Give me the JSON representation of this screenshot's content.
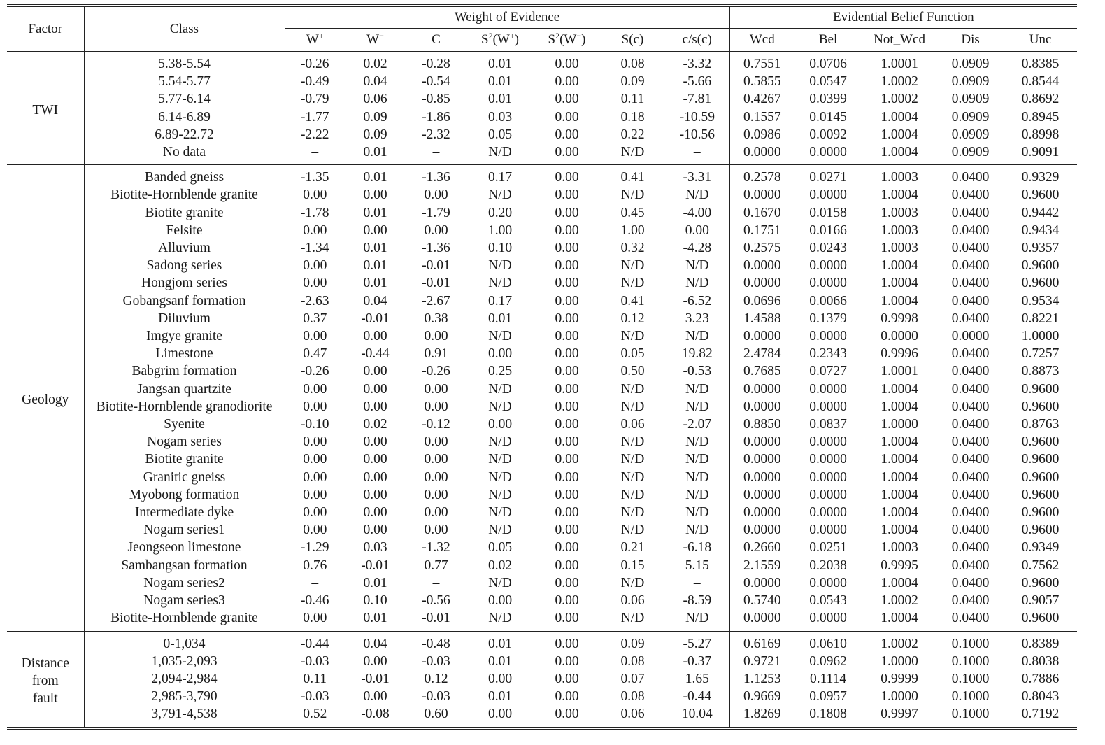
{
  "header": {
    "factor": "Factor",
    "class": "Class",
    "woe_group": "Weight of Evidence",
    "ebf_group": "Evidential Belief Function",
    "columns": [
      {
        "base": "W",
        "sup": "+"
      },
      {
        "base": "W",
        "sup": "−"
      },
      {
        "base": "C",
        "sup": ""
      },
      {
        "base": "S",
        "sup": "2",
        "tail": "(W",
        "sup2": "+",
        "end": ")"
      },
      {
        "base": "S",
        "sup": "2",
        "tail": "(W",
        "sup2": "−",
        "end": ")"
      },
      {
        "base": "S(c)",
        "sup": ""
      },
      {
        "base": "c/s(c)",
        "sup": ""
      },
      {
        "base": "Wcd",
        "sup": ""
      },
      {
        "base": "Bel",
        "sup": ""
      },
      {
        "base": "Not_Wcd",
        "sup": ""
      },
      {
        "base": "Dis",
        "sup": ""
      },
      {
        "base": "Unc",
        "sup": ""
      }
    ]
  },
  "groups": [
    {
      "factor": "TWI",
      "rows": [
        [
          "5.38-5.54",
          "-0.26",
          "0.02",
          "-0.28",
          "0.01",
          "0.00",
          "0.08",
          "-3.32",
          "0.7551",
          "0.0706",
          "1.0001",
          "0.0909",
          "0.8385"
        ],
        [
          "5.54-5.77",
          "-0.49",
          "0.04",
          "-0.54",
          "0.01",
          "0.00",
          "0.09",
          "-5.66",
          "0.5855",
          "0.0547",
          "1.0002",
          "0.0909",
          "0.8544"
        ],
        [
          "5.77-6.14",
          "-0.79",
          "0.06",
          "-0.85",
          "0.01",
          "0.00",
          "0.11",
          "-7.81",
          "0.4267",
          "0.0399",
          "1.0002",
          "0.0909",
          "0.8692"
        ],
        [
          "6.14-6.89",
          "-1.77",
          "0.09",
          "-1.86",
          "0.03",
          "0.00",
          "0.18",
          "-10.59",
          "0.1557",
          "0.0145",
          "1.0004",
          "0.0909",
          "0.8945"
        ],
        [
          "6.89-22.72",
          "-2.22",
          "0.09",
          "-2.32",
          "0.05",
          "0.00",
          "0.22",
          "-10.56",
          "0.0986",
          "0.0092",
          "1.0004",
          "0.0909",
          "0.8998"
        ],
        [
          "No data",
          "–",
          "0.01",
          "–",
          "N/D",
          "0.00",
          "N/D",
          "–",
          "0.0000",
          "0.0000",
          "1.0004",
          "0.0909",
          "0.9091"
        ]
      ]
    },
    {
      "factor": "Geology",
      "rows": [
        [
          "Banded gneiss",
          "-1.35",
          "0.01",
          "-1.36",
          "0.17",
          "0.00",
          "0.41",
          "-3.31",
          "0.2578",
          "0.0271",
          "1.0003",
          "0.0400",
          "0.9329"
        ],
        [
          "Biotite-Hornblende granite",
          "0.00",
          "0.00",
          "0.00",
          "N/D",
          "0.00",
          "N/D",
          "N/D",
          "0.0000",
          "0.0000",
          "1.0004",
          "0.0400",
          "0.9600"
        ],
        [
          "Biotite granite",
          "-1.78",
          "0.01",
          "-1.79",
          "0.20",
          "0.00",
          "0.45",
          "-4.00",
          "0.1670",
          "0.0158",
          "1.0003",
          "0.0400",
          "0.9442"
        ],
        [
          "Felsite",
          "0.00",
          "0.00",
          "0.00",
          "1.00",
          "0.00",
          "1.00",
          "0.00",
          "0.1751",
          "0.0166",
          "1.0003",
          "0.0400",
          "0.9434"
        ],
        [
          "Alluvium",
          "-1.34",
          "0.01",
          "-1.36",
          "0.10",
          "0.00",
          "0.32",
          "-4.28",
          "0.2575",
          "0.0243",
          "1.0003",
          "0.0400",
          "0.9357"
        ],
        [
          "Sadong series",
          "0.00",
          "0.01",
          "-0.01",
          "N/D",
          "0.00",
          "N/D",
          "N/D",
          "0.0000",
          "0.0000",
          "1.0004",
          "0.0400",
          "0.9600"
        ],
        [
          "Hongjom series",
          "0.00",
          "0.01",
          "-0.01",
          "N/D",
          "0.00",
          "N/D",
          "N/D",
          "0.0000",
          "0.0000",
          "1.0004",
          "0.0400",
          "0.9600"
        ],
        [
          "Gobangsanf formation",
          "-2.63",
          "0.04",
          "-2.67",
          "0.17",
          "0.00",
          "0.41",
          "-6.52",
          "0.0696",
          "0.0066",
          "1.0004",
          "0.0400",
          "0.9534"
        ],
        [
          "Diluvium",
          "0.37",
          "-0.01",
          "0.38",
          "0.01",
          "0.00",
          "0.12",
          "3.23",
          "1.4588",
          "0.1379",
          "0.9998",
          "0.0400",
          "0.8221"
        ],
        [
          "Imgye granite",
          "0.00",
          "0.00",
          "0.00",
          "N/D",
          "0.00",
          "N/D",
          "N/D",
          "0.0000",
          "0.0000",
          "0.0000",
          "0.0000",
          "1.0000"
        ],
        [
          "Limestone",
          "0.47",
          "-0.44",
          "0.91",
          "0.00",
          "0.00",
          "0.05",
          "19.82",
          "2.4784",
          "0.2343",
          "0.9996",
          "0.0400",
          "0.7257"
        ],
        [
          "Babgrim formation",
          "-0.26",
          "0.00",
          "-0.26",
          "0.25",
          "0.00",
          "0.50",
          "-0.53",
          "0.7685",
          "0.0727",
          "1.0001",
          "0.0400",
          "0.8873"
        ],
        [
          "Jangsan quartzite",
          "0.00",
          "0.00",
          "0.00",
          "N/D",
          "0.00",
          "N/D",
          "N/D",
          "0.0000",
          "0.0000",
          "1.0004",
          "0.0400",
          "0.9600"
        ],
        [
          "Biotite-Hornblende granodiorite",
          "0.00",
          "0.00",
          "0.00",
          "N/D",
          "0.00",
          "N/D",
          "N/D",
          "0.0000",
          "0.0000",
          "1.0004",
          "0.0400",
          "0.9600"
        ],
        [
          "Syenite",
          "-0.10",
          "0.02",
          "-0.12",
          "0.00",
          "0.00",
          "0.06",
          "-2.07",
          "0.8850",
          "0.0837",
          "1.0000",
          "0.0400",
          "0.8763"
        ],
        [
          "Nogam series",
          "0.00",
          "0.00",
          "0.00",
          "N/D",
          "0.00",
          "N/D",
          "N/D",
          "0.0000",
          "0.0000",
          "1.0004",
          "0.0400",
          "0.9600"
        ],
        [
          "Biotite granite",
          "0.00",
          "0.00",
          "0.00",
          "N/D",
          "0.00",
          "N/D",
          "N/D",
          "0.0000",
          "0.0000",
          "1.0004",
          "0.0400",
          "0.9600"
        ],
        [
          "Granitic gneiss",
          "0.00",
          "0.00",
          "0.00",
          "N/D",
          "0.00",
          "N/D",
          "N/D",
          "0.0000",
          "0.0000",
          "1.0004",
          "0.0400",
          "0.9600"
        ],
        [
          "Myobong formation",
          "0.00",
          "0.00",
          "0.00",
          "N/D",
          "0.00",
          "N/D",
          "N/D",
          "0.0000",
          "0.0000",
          "1.0004",
          "0.0400",
          "0.9600"
        ],
        [
          "Intermediate dyke",
          "0.00",
          "0.00",
          "0.00",
          "N/D",
          "0.00",
          "N/D",
          "N/D",
          "0.0000",
          "0.0000",
          "1.0004",
          "0.0400",
          "0.9600"
        ],
        [
          "Nogam series1",
          "0.00",
          "0.00",
          "0.00",
          "N/D",
          "0.00",
          "N/D",
          "N/D",
          "0.0000",
          "0.0000",
          "1.0004",
          "0.0400",
          "0.9600"
        ],
        [
          "Jeongseon limestone",
          "-1.29",
          "0.03",
          "-1.32",
          "0.05",
          "0.00",
          "0.21",
          "-6.18",
          "0.2660",
          "0.0251",
          "1.0003",
          "0.0400",
          "0.9349"
        ],
        [
          "Sambangsan formation",
          "0.76",
          "-0.01",
          "0.77",
          "0.02",
          "0.00",
          "0.15",
          "5.15",
          "2.1559",
          "0.2038",
          "0.9995",
          "0.0400",
          "0.7562"
        ],
        [
          "Nogam series2",
          "–",
          "0.01",
          "–",
          "N/D",
          "0.00",
          "N/D",
          "–",
          "0.0000",
          "0.0000",
          "1.0004",
          "0.0400",
          "0.9600"
        ],
        [
          "Nogam series3",
          "-0.46",
          "0.10",
          "-0.56",
          "0.00",
          "0.00",
          "0.06",
          "-8.59",
          "0.5740",
          "0.0543",
          "1.0002",
          "0.0400",
          "0.9057"
        ],
        [
          "Biotite-Hornblende granite",
          "0.00",
          "0.01",
          "-0.01",
          "N/D",
          "0.00",
          "N/D",
          "N/D",
          "0.0000",
          "0.0000",
          "1.0004",
          "0.0400",
          "0.9600"
        ]
      ]
    },
    {
      "factor": "Distance from fault",
      "factor_lines": [
        "Distance",
        "from",
        "fault"
      ],
      "rows": [
        [
          "0-1,034",
          "-0.44",
          "0.04",
          "-0.48",
          "0.01",
          "0.00",
          "0.09",
          "-5.27",
          "0.6169",
          "0.0610",
          "1.0002",
          "0.1000",
          "0.8389"
        ],
        [
          "1,035-2,093",
          "-0.03",
          "0.00",
          "-0.03",
          "0.01",
          "0.00",
          "0.08",
          "-0.37",
          "0.9721",
          "0.0962",
          "1.0000",
          "0.1000",
          "0.8038"
        ],
        [
          "2,094-2,984",
          "0.11",
          "-0.01",
          "0.12",
          "0.00",
          "0.00",
          "0.07",
          "1.65",
          "1.1253",
          "0.1114",
          "0.9999",
          "0.1000",
          "0.7886"
        ],
        [
          "2,985-3,790",
          "-0.03",
          "0.00",
          "-0.03",
          "0.01",
          "0.00",
          "0.08",
          "-0.44",
          "0.9669",
          "0.0957",
          "1.0000",
          "0.1000",
          "0.8043"
        ],
        [
          "3,791-4,538",
          "0.52",
          "-0.08",
          "0.60",
          "0.00",
          "0.00",
          "0.06",
          "10.04",
          "1.8269",
          "0.1808",
          "0.9997",
          "0.1000",
          "0.7192"
        ]
      ]
    }
  ]
}
